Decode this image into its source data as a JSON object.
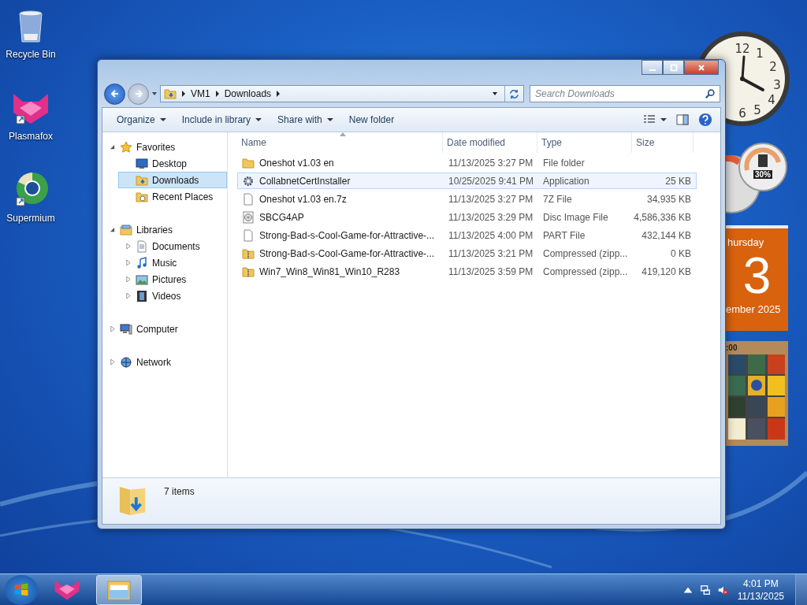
{
  "desktop_icons": [
    {
      "label": "Recycle Bin",
      "kind": "recycle"
    },
    {
      "label": "Plasmafox",
      "kind": "plasmafox"
    },
    {
      "label": "Supermium",
      "kind": "supermium"
    }
  ],
  "gadgets": {
    "clock": {
      "numerals": [
        "12",
        "1",
        "2",
        "3",
        "4",
        "5",
        "6"
      ]
    },
    "meter": {
      "reading": "30%"
    },
    "calendar": {
      "weekday": "hursday",
      "day": "3",
      "month": "ember 2025"
    },
    "puzzle": {
      "timer": ":00"
    }
  },
  "window": {
    "back": {
      "disabled": false
    },
    "forward": {
      "disabled": true
    },
    "breadcrumb": [
      "VM1",
      "Downloads"
    ],
    "search": {
      "placeholder": "Search Downloads"
    },
    "toolbar": [
      {
        "label": "Organize",
        "dropdown": true
      },
      {
        "label": "Include in library",
        "dropdown": true
      },
      {
        "label": "Share with",
        "dropdown": true
      },
      {
        "label": "New folder",
        "dropdown": false
      }
    ],
    "nav": [
      {
        "label": "Favorites",
        "kind": "star",
        "expanded": true,
        "selected": false,
        "children": [
          {
            "label": "Desktop",
            "kind": "desktop",
            "selected": false
          },
          {
            "label": "Downloads",
            "kind": "downloads",
            "selected": true
          },
          {
            "label": "Recent Places",
            "kind": "recent",
            "selected": false
          }
        ]
      },
      {
        "label": "Libraries",
        "kind": "library",
        "expanded": true,
        "selected": false,
        "children": [
          {
            "label": "Documents",
            "kind": "documents",
            "expanded": false,
            "selected": false
          },
          {
            "label": "Music",
            "kind": "music",
            "expanded": false,
            "selected": false
          },
          {
            "label": "Pictures",
            "kind": "pictures",
            "expanded": false,
            "selected": false
          },
          {
            "label": "Videos",
            "kind": "videos",
            "expanded": false,
            "selected": false
          }
        ]
      },
      {
        "label": "Computer",
        "kind": "computer",
        "expanded": false,
        "selected": false
      },
      {
        "label": "Network",
        "kind": "network",
        "expanded": false,
        "selected": false
      }
    ],
    "columns": [
      {
        "label": "Name",
        "sorted": true
      },
      {
        "label": "Date modified",
        "sorted": false
      },
      {
        "label": "Type",
        "sorted": false
      },
      {
        "label": "Size",
        "sorted": false
      }
    ],
    "files": [
      {
        "name": "Oneshot v1.03 en",
        "date": "11/13/2025 3:27 PM",
        "type": "File folder",
        "kind": "folder",
        "hovered": false
      },
      {
        "name": "CollabnetCertInstaller",
        "date": "10/25/2025 9:41 PM",
        "type": "Application",
        "size": "25 KB",
        "kind": "app",
        "hovered": true
      },
      {
        "name": "Oneshot v1.03 en.7z",
        "date": "11/13/2025 3:27 PM",
        "type": "7Z File",
        "size": "34,935 KB",
        "kind": "file",
        "hovered": false
      },
      {
        "name": "SBCG4AP",
        "date": "11/13/2025 3:29 PM",
        "type": "Disc Image File",
        "size": "4,586,336 KB",
        "kind": "disc",
        "hovered": false
      },
      {
        "name": "Strong-Bad-s-Cool-Game-for-Attractive-...",
        "date": "11/13/2025 4:00 PM",
        "type": "PART File",
        "size": "432,144 KB",
        "kind": "file",
        "hovered": false
      },
      {
        "name": "Strong-Bad-s-Cool-Game-for-Attractive-...",
        "date": "11/13/2025 3:21 PM",
        "type": "Compressed (zipp...",
        "size": "0 KB",
        "kind": "zip",
        "hovered": false
      },
      {
        "name": "Win7_Win8_Win81_Win10_R283",
        "date": "11/13/2025 3:59 PM",
        "type": "Compressed (zipp...",
        "size": "419,120 KB",
        "kind": "zip",
        "hovered": false
      }
    ],
    "status": "7 items"
  },
  "taskbar": {
    "apps": [
      {
        "kind": "plasmafox",
        "active": false
      },
      {
        "kind": "explorer",
        "active": true
      }
    ],
    "time": "4:01 PM",
    "date": "11/13/2025",
    "muted": true
  }
}
